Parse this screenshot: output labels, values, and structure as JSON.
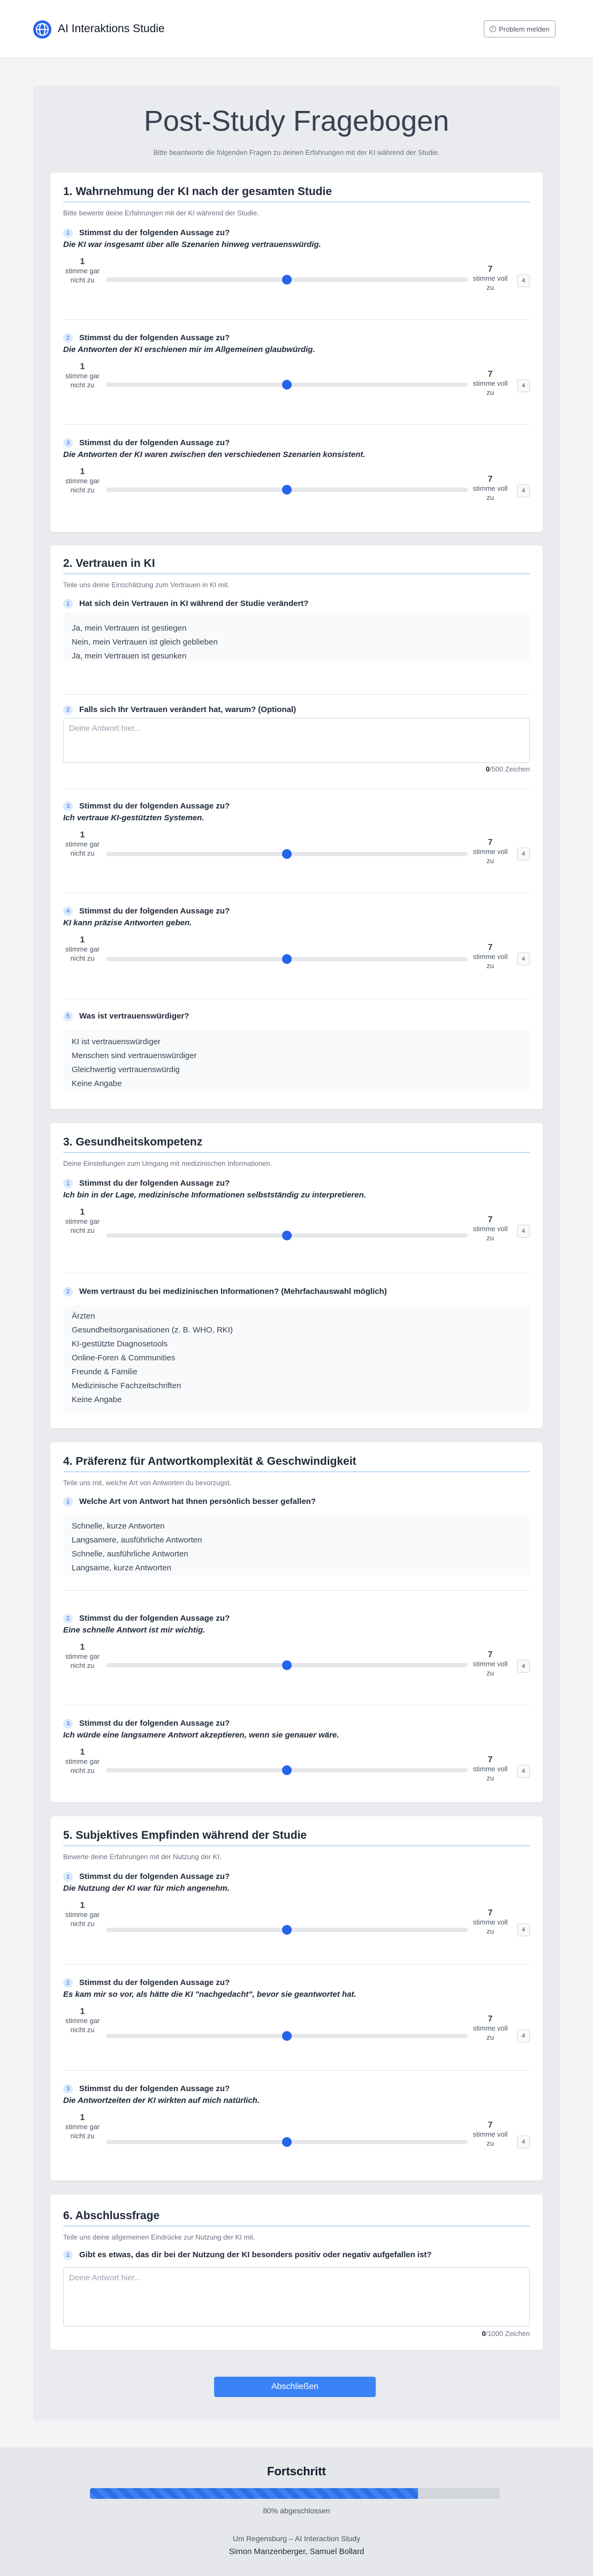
{
  "app": {
    "title": "AI Interaktions Studie",
    "report_button": "Problem melden"
  },
  "page": {
    "title": "Post-Study Fragebogen",
    "subtitle": "Bitte beantworte die folgenden Fragen zu deinen Erfahrungen mit der KI während der Studie."
  },
  "scale": {
    "left_num": "1",
    "left_text": "stimme gar nicht zu",
    "right_num": "7",
    "right_text": "stimme voll zu",
    "min": 1,
    "max": 7
  },
  "sections": [
    {
      "title": "1. Wahrnehmung der KI nach der gesamten Studie",
      "description": "Bitte bewerte deine Erfahrungen mit der KI während der Studie.",
      "questions": [
        {
          "num": "1",
          "head": "Stimmst du der folgenden Aussage zu?",
          "statement": "Die KI war insgesamt über alle Szenarien hinweg vertrauenswürdig.",
          "value": 4,
          "value_label": "4"
        },
        {
          "num": "2",
          "head": "Stimmst du der folgenden Aussage zu?",
          "statement": "Die Antworten der KI erschienen mir im Allgemeinen glaubwürdig.",
          "value": 4,
          "value_label": "4"
        },
        {
          "num": "3",
          "head": "Stimmst du der folgenden Aussage zu?",
          "statement": "Die Antworten der KI waren zwischen den verschiedenen Szenarien konsistent.",
          "value": 4,
          "value_label": "4"
        }
      ]
    },
    {
      "title": "2. Vertrauen in KI",
      "description": "Teile uns deine Einschätzung zum Vertrauen in KI mit.",
      "questions": [
        {
          "num": "1",
          "head": "Hat sich dein Vertrauen in KI während der Studie verändert?",
          "options": [
            "Ja, mein Vertrauen ist gestiegen",
            "Nein, mein Vertrauen ist gleich geblieben",
            "Ja, mein Vertrauen ist gesunken"
          ]
        },
        {
          "num": "2",
          "head": "Falls sich Ihr Vertrauen verändert hat, warum? (Optional)",
          "placeholder": "Deine Antwort hier...",
          "count": "0",
          "count_suffix": "/500 Zeichen"
        },
        {
          "num": "3",
          "head": "Stimmst du der folgenden Aussage zu?",
          "statement": "Ich vertraue KI-gestützten Systemen.",
          "value": 4,
          "value_label": "4"
        },
        {
          "num": "4",
          "head": "Stimmst du der folgenden Aussage zu?",
          "statement": "KI kann präzise Antworten geben.",
          "value": 4,
          "value_label": "4"
        },
        {
          "num": "5",
          "head": "Was ist vertrauenswürdiger?",
          "options": [
            "KI ist vertrauenswürdiger",
            "Menschen sind vertrauenswürdiger",
            "Gleichwertig vertrauenswürdig",
            "Keine Angabe"
          ]
        }
      ]
    },
    {
      "title": "3. Gesundheitskompetenz",
      "description": "Deine Einstellungen zum Umgang mit medizinischen Informationen.",
      "questions": [
        {
          "num": "1",
          "head": "Stimmst du der folgenden Aussage zu?",
          "statement": "Ich bin in der Lage, medizinische Informationen selbstständig zu interpretieren.",
          "value": 4,
          "value_label": "4"
        },
        {
          "num": "2",
          "head": "Wem vertraust du bei medizinischen Informationen? (Mehrfachauswahl möglich)",
          "options": [
            "Ärzten",
            "Gesundheitsorganisationen (z. B. WHO, RKI)",
            "KI-gestützte Diagnosetools",
            "Online-Foren & Communities",
            "Freunde & Familie",
            "Medizinische Fachzeitschriften",
            "Keine Angabe"
          ]
        }
      ]
    },
    {
      "title": "4. Präferenz für Antwortkomplexität & Geschwindigkeit",
      "description": "Teile uns mit, welche Art von Antworten du bevorzugst.",
      "questions": [
        {
          "num": "1",
          "head": "Welche Art von Antwort hat Ihnen persönlich besser gefallen?",
          "options": [
            "Schnelle, kurze Antworten",
            "Langsamere, ausführliche Antworten",
            "Schnelle, ausführliche Antworten",
            "Langsame, kurze Antworten"
          ]
        },
        {
          "num": "2",
          "head": "Stimmst du der folgenden Aussage zu?",
          "statement": "Eine schnelle Antwort ist mir wichtig.",
          "value": 4,
          "value_label": "4"
        },
        {
          "num": "3",
          "head": "Stimmst du der folgenden Aussage zu?",
          "statement": "Ich würde eine langsamere Antwort akzeptieren, wenn sie genauer wäre.",
          "value": 4,
          "value_label": "4"
        }
      ]
    },
    {
      "title": "5. Subjektives Empfinden während der Studie",
      "description": "Bewerte deine Erfahrungen mit der Nutzung der KI.",
      "questions": [
        {
          "num": "1",
          "head": "Stimmst du der folgenden Aussage zu?",
          "statement": "Die Nutzung der KI war für mich angenehm.",
          "value": 4,
          "value_label": "4"
        },
        {
          "num": "2",
          "head": "Stimmst du der folgenden Aussage zu?",
          "statement": "Es kam mir so vor, als hätte die KI \"nachgedacht\", bevor sie geantwortet hat.",
          "value": 4,
          "value_label": "4"
        },
        {
          "num": "3",
          "head": "Stimmst du der folgenden Aussage zu?",
          "statement": "Die Antwortzeiten der KI wirkten auf mich natürlich.",
          "value": 4,
          "value_label": "4"
        }
      ]
    },
    {
      "title": "6. Abschlussfrage",
      "description": "Teile uns deine allgemeinen Eindrücke zur Nutzung der KI mit.",
      "questions": [
        {
          "num": "1",
          "head": "Gibt es etwas, das dir bei der Nutzung der KI besonders positiv oder negativ aufgefallen ist?",
          "placeholder": "Deine Antwort hier...",
          "count": "0",
          "count_suffix": "/1000 Zeichen"
        }
      ]
    }
  ],
  "actions": {
    "finish": "Abschließen"
  },
  "progress": {
    "title": "Fortschritt",
    "value": 0.8,
    "label": "80% abgeschlossen"
  },
  "footer": {
    "line1": "Uni Regensburg – AI Interaction Study",
    "line2": "Simon Manzenberger, Samuel Bollard"
  },
  "colors": {
    "accent": "#2563eb",
    "button": "#3b82f6"
  }
}
